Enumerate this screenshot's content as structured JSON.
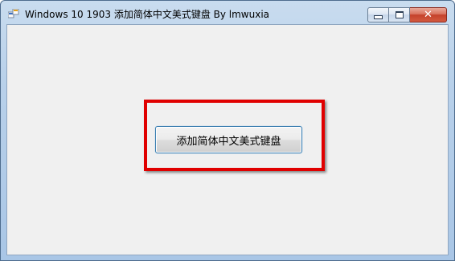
{
  "window": {
    "title": "Windows 10 1903 添加简体中文美式键盘 By lmwuxia",
    "icon": "window-app-icon"
  },
  "caption_buttons": {
    "minimize_icon": "minimize-icon",
    "maximize_icon": "maximize-icon",
    "close_icon": "close-icon",
    "close_glyph": "✕"
  },
  "main": {
    "button_label": "添加简体中文美式键盘"
  },
  "colors": {
    "highlight": "#e00000",
    "close_button": "#c4412b",
    "client_background": "#f0f0f0",
    "button_border": "#3c7fb1"
  }
}
